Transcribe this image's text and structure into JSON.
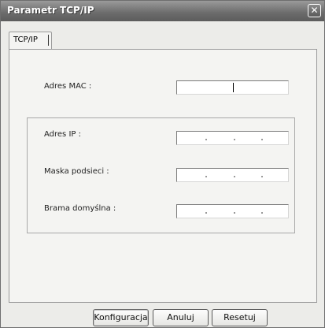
{
  "window": {
    "title": "Parametr TCP/IP",
    "close_symbol": "✕"
  },
  "tabs": [
    {
      "label": "TCP/IP"
    }
  ],
  "fields": {
    "mac": {
      "label": "Adres MAC :",
      "value": ""
    },
    "ip": {
      "label": "Adres IP :",
      "value": ""
    },
    "mask": {
      "label": "Maska podsieci :",
      "value": ""
    },
    "gateway": {
      "label": "Brama domyślna :",
      "value": ""
    }
  },
  "buttons": {
    "configure": "Konfiguracja",
    "cancel": "Anuluj",
    "reset": "Resetuj"
  }
}
